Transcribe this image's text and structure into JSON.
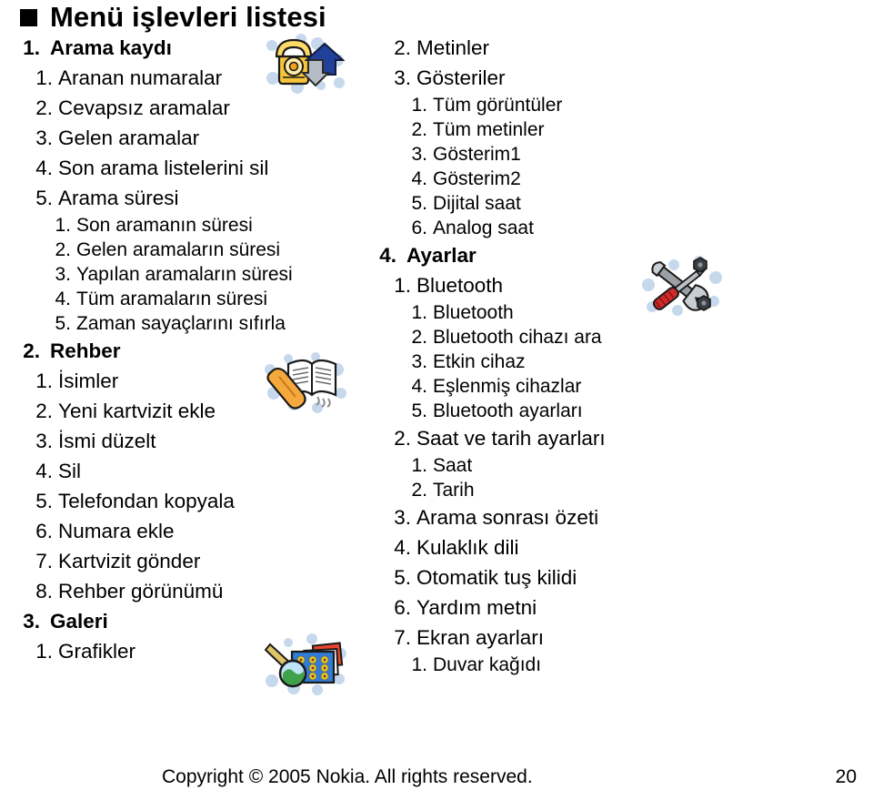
{
  "page": {
    "title": "Menü işlevleri listesi",
    "bullet_color": "#000000"
  },
  "footer": {
    "copyright": "Copyright © 2005 Nokia. All rights reserved.",
    "page_number": "20"
  },
  "icons": {
    "call_log": "call-log-icon",
    "phonebook": "phonebook-icon",
    "gallery": "gallery-icon",
    "settings": "settings-icon"
  },
  "left_column": [
    {
      "level": 1,
      "num": "1.",
      "label": "Arama kaydı"
    },
    {
      "level": 2,
      "num": "1.",
      "label": "Aranan numaralar"
    },
    {
      "level": 2,
      "num": "2.",
      "label": "Cevapsız aramalar"
    },
    {
      "level": 2,
      "num": "3.",
      "label": "Gelen aramalar"
    },
    {
      "level": 2,
      "num": "4.",
      "label": "Son arama listelerini sil"
    },
    {
      "level": 2,
      "num": "5.",
      "label": "Arama süresi"
    },
    {
      "level": 3,
      "num": "1.",
      "label": "Son aramanın süresi"
    },
    {
      "level": 3,
      "num": "2.",
      "label": "Gelen aramaların süresi"
    },
    {
      "level": 3,
      "num": "3.",
      "label": "Yapılan aramaların süresi"
    },
    {
      "level": 3,
      "num": "4.",
      "label": "Tüm aramaların süresi"
    },
    {
      "level": 3,
      "num": "5.",
      "label": "Zaman sayaçlarını sıfırla"
    },
    {
      "level": 1,
      "num": "2.",
      "label": "Rehber"
    },
    {
      "level": 2,
      "num": "1.",
      "label": "İsimler"
    },
    {
      "level": 2,
      "num": "2.",
      "label": "Yeni kartvizit ekle"
    },
    {
      "level": 2,
      "num": "3.",
      "label": "İsmi düzelt"
    },
    {
      "level": 2,
      "num": "4.",
      "label": "Sil"
    },
    {
      "level": 2,
      "num": "5.",
      "label": "Telefondan kopyala"
    },
    {
      "level": 2,
      "num": "6.",
      "label": "Numara ekle"
    },
    {
      "level": 2,
      "num": "7.",
      "label": "Kartvizit gönder"
    },
    {
      "level": 2,
      "num": "8.",
      "label": "Rehber görünümü"
    },
    {
      "level": 1,
      "num": "3.",
      "label": "Galeri"
    },
    {
      "level": 2,
      "num": "1.",
      "label": "Grafikler"
    }
  ],
  "right_column": [
    {
      "level": 2,
      "num": "2.",
      "label": "Metinler"
    },
    {
      "level": 2,
      "num": "3.",
      "label": "Gösteriler"
    },
    {
      "level": 3,
      "num": "1.",
      "label": "Tüm görüntüler"
    },
    {
      "level": 3,
      "num": "2.",
      "label": "Tüm metinler"
    },
    {
      "level": 3,
      "num": "3.",
      "label": "Gösterim1"
    },
    {
      "level": 3,
      "num": "4.",
      "label": "Gösterim2"
    },
    {
      "level": 3,
      "num": "5.",
      "label": "Dijital saat"
    },
    {
      "level": 3,
      "num": "6.",
      "label": "Analog saat"
    },
    {
      "level": 1,
      "num": "4.",
      "label": "Ayarlar"
    },
    {
      "level": 2,
      "num": "1.",
      "label": "Bluetooth"
    },
    {
      "level": 3,
      "num": "1.",
      "label": "Bluetooth"
    },
    {
      "level": 3,
      "num": "2.",
      "label": "Bluetooth cihazı ara"
    },
    {
      "level": 3,
      "num": "3.",
      "label": "Etkin cihaz"
    },
    {
      "level": 3,
      "num": "4.",
      "label": "Eşlenmiş cihazlar"
    },
    {
      "level": 3,
      "num": "5.",
      "label": "Bluetooth ayarları"
    },
    {
      "level": 2,
      "num": "2.",
      "label": "Saat ve tarih ayarları"
    },
    {
      "level": 3,
      "num": "1.",
      "label": "Saat"
    },
    {
      "level": 3,
      "num": "2.",
      "label": "Tarih"
    },
    {
      "level": 2,
      "num": "3.",
      "label": "Arama sonrası özeti"
    },
    {
      "level": 2,
      "num": "4.",
      "label": "Kulaklık dili"
    },
    {
      "level": 2,
      "num": "5.",
      "label": "Otomatik tuş kilidi"
    },
    {
      "level": 2,
      "num": "6.",
      "label": "Yardım metni"
    },
    {
      "level": 2,
      "num": "7.",
      "label": "Ekran ayarları"
    },
    {
      "level": 3,
      "num": "1.",
      "label": "Duvar kağıdı"
    }
  ]
}
